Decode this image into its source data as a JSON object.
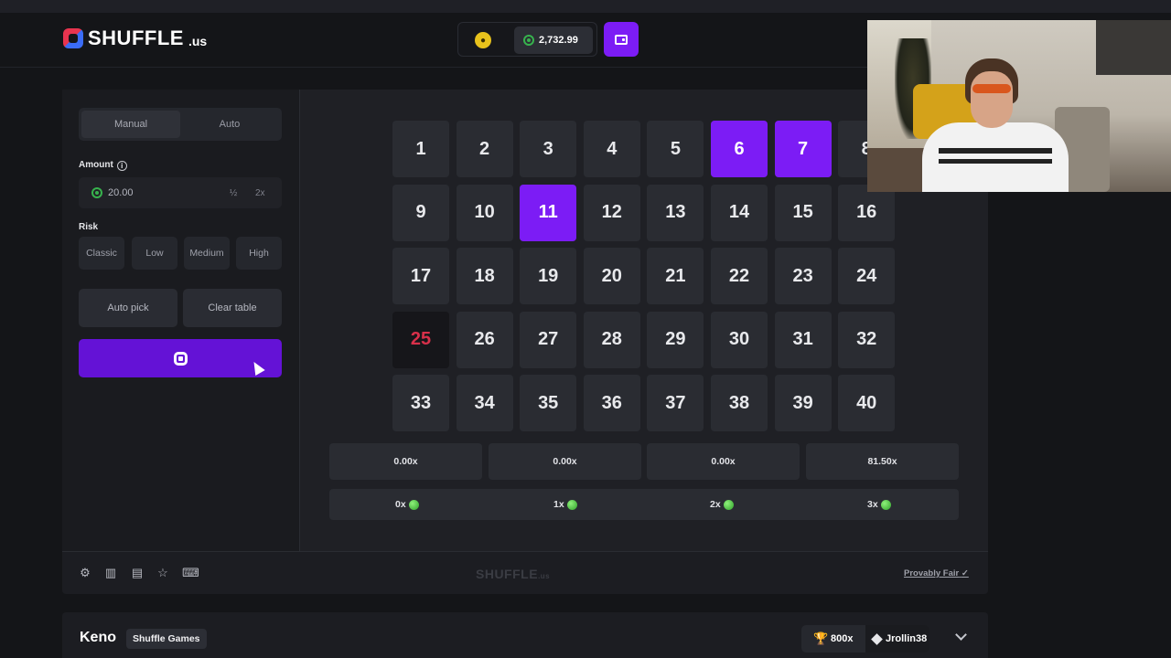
{
  "header": {
    "logo_text": "SHUFFLE",
    "logo_tld": ".us",
    "balance": "2,732.99"
  },
  "sidebar": {
    "tabs": [
      {
        "label": "Manual",
        "active": true
      },
      {
        "label": "Auto",
        "active": false
      }
    ],
    "amount_label": "Amount",
    "amount_value": "20.00",
    "half_label": "½",
    "double_label": "2x",
    "risk_label": "Risk",
    "risk_options": [
      "Classic",
      "Low",
      "Medium",
      "High"
    ],
    "auto_pick_label": "Auto pick",
    "clear_table_label": "Clear table"
  },
  "board": {
    "tiles": [
      "1",
      "2",
      "3",
      "4",
      "5",
      "6",
      "7",
      "8",
      "9",
      "10",
      "11",
      "12",
      "13",
      "14",
      "15",
      "16",
      "17",
      "18",
      "19",
      "20",
      "21",
      "22",
      "23",
      "24",
      "25",
      "26",
      "27",
      "28",
      "29",
      "30",
      "31",
      "32",
      "33",
      "34",
      "35",
      "36",
      "37",
      "38",
      "39",
      "40"
    ],
    "selected": [
      "6",
      "7",
      "11"
    ],
    "missed": [
      "25"
    ],
    "selected_color": "#7c1cf5",
    "missed_color": "#d8304a"
  },
  "payouts": [
    "0.00x",
    "0.00x",
    "0.00x",
    "81.50x"
  ],
  "hits": [
    "0x",
    "1x",
    "2x",
    "3x"
  ],
  "footer": {
    "icons": [
      "settings-icon",
      "barcode-icon",
      "stats-icon",
      "star-icon",
      "keyboard-icon"
    ],
    "logo_text": "SHUFFLE",
    "logo_tld": ".us",
    "provably_fair": "Provably Fair"
  },
  "bottom": {
    "game_name": "Keno",
    "provider": "Shuffle Games",
    "top_multiplier": "800x",
    "top_user": "Jrollin38"
  }
}
